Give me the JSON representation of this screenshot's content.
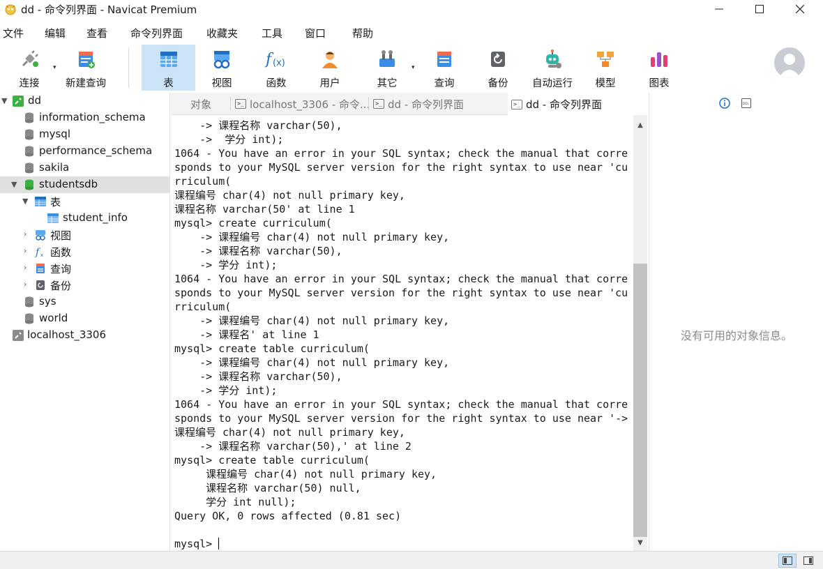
{
  "window": {
    "title": "dd - 命令列界面 - Navicat Premium",
    "accent_color": "#cce4f7"
  },
  "menu": [
    "文件",
    "编辑",
    "查看",
    "命令列界面",
    "收藏夹",
    "工具",
    "窗口",
    "帮助"
  ],
  "toolbar": {
    "connect": "连接",
    "new_query": "新建查询",
    "table": "表",
    "view": "视图",
    "function": "函数",
    "user": "用户",
    "other": "其它",
    "query": "查询",
    "backup": "备份",
    "automation": "自动运行",
    "model": "模型",
    "chart": "图表"
  },
  "tree": {
    "dd": "dd",
    "information_schema": "information_schema",
    "mysql": "mysql",
    "performance_schema": "performance_schema",
    "sakila": "sakila",
    "studentsdb": "studentsdb",
    "tables": "表",
    "student_info": "student_info",
    "views": "视图",
    "functions": "函数",
    "queries": "查询",
    "backups": "备份",
    "sys": "sys",
    "world": "world",
    "localhost": "localhost_3306"
  },
  "tabs": {
    "objects": "对象",
    "tab1": "localhost_3306 - 命令...",
    "tab2": "dd - 命令列界面",
    "tab3": "dd - 命令列界面"
  },
  "console": {
    "lines": [
      "    -> 课程名称 varchar(50),",
      "    ->  学分 int);",
      "1064 - You have an error in your SQL syntax; check the manual that corre",
      "sponds to your MySQL server version for the right syntax to use near 'cu",
      "rriculum(",
      "课程编号 char(4) not null primary key,",
      "课程名称 varchar(50' at line 1",
      "mysql> create curriculum(",
      "    -> 课程编号 char(4) not null primary key,",
      "    -> 课程名称 varchar(50),",
      "    -> 学分 int);",
      "1064 - You have an error in your SQL syntax; check the manual that corre",
      "sponds to your MySQL server version for the right syntax to use near 'cu",
      "rriculum(",
      "    -> 课程编号 char(4) not null primary key,",
      "    -> 课程名' at line 1",
      "mysql> create table curriculum(",
      "    -> 课程编号 char(4) not null primary key,",
      "    -> 课程名称 varchar(50),",
      "    -> 学分 int);",
      "1064 - You have an error in your SQL syntax; check the manual that corre",
      "sponds to your MySQL server version for the right syntax to use near '->",
      "课程编号 char(4) not null primary key,",
      "    -> 课程名称 varchar(50),' at line 2",
      "mysql> create table curriculum(",
      "     课程编号 char(4) not null primary key,",
      "     课程名称 varchar(50) null,",
      "     学分 int null);",
      "Query OK, 0 rows affected (0.81 sec)",
      ""
    ],
    "prompt": "mysql> "
  },
  "info_panel": {
    "empty_text": "没有可用的对象信息。"
  }
}
